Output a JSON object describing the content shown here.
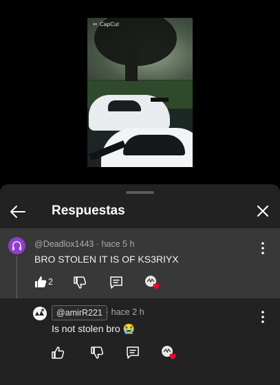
{
  "video": {
    "watermark": "CapCut"
  },
  "sheet": {
    "title": "Respuestas"
  },
  "parent_comment": {
    "author": "@Deadlox1443",
    "time": "· hace 5 h",
    "text": "BRO STOLEN IT IS OF KS3RIYX",
    "like_count": "2"
  },
  "reply_comment": {
    "author": "@amirR221",
    "time": "· hace 2 h",
    "text": "Is not stolen bro 😭"
  },
  "colors": {
    "sheet_bg": "#222222",
    "parent_bg": "#383838",
    "heart": "#ff0033",
    "avatar": "#8e3fc9"
  },
  "icons": [
    "back-arrow-icon",
    "close-icon",
    "more-vert-icon",
    "thumb-up-icon",
    "thumb-down-icon",
    "reply-icon",
    "creator-heart-icon"
  ]
}
